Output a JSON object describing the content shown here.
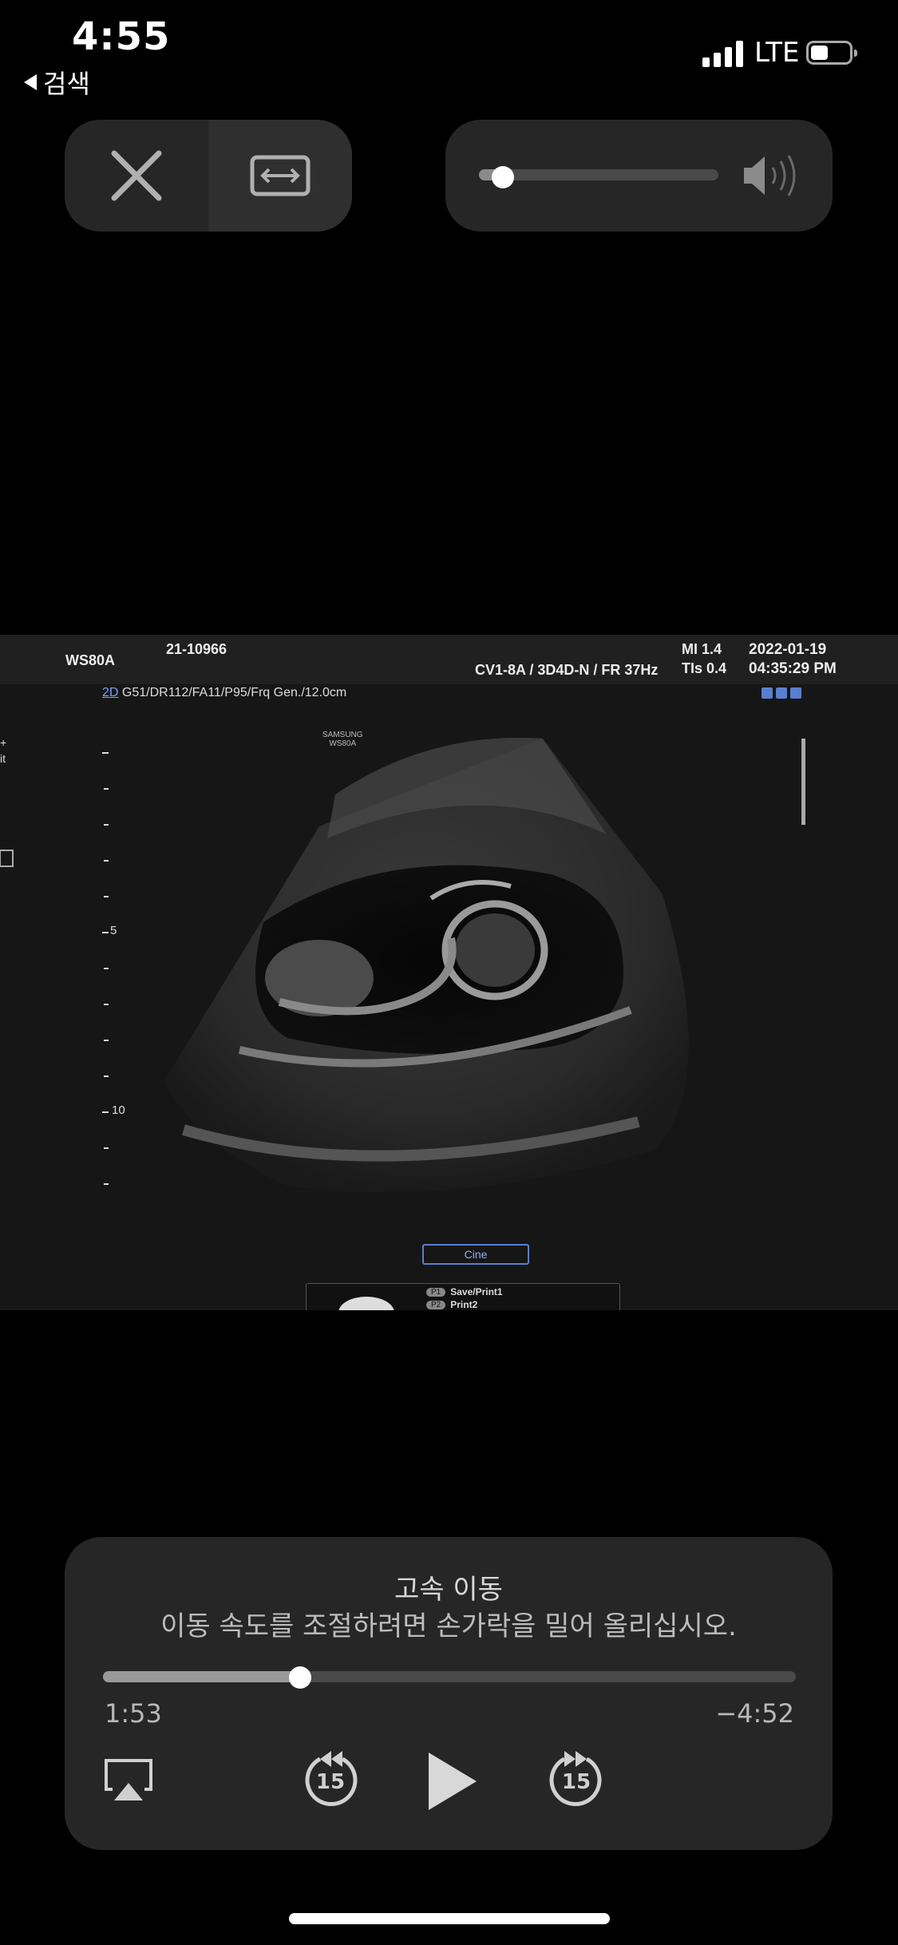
{
  "status_bar": {
    "time": "4:55",
    "back_label": "검색",
    "network": "LTE",
    "battery_level": 0.45
  },
  "controls": {
    "close_icon": "close-x-icon",
    "aspect_icon": "expand-horizontal-icon",
    "volume_level": 0.1,
    "volume_icon": "speaker-icon"
  },
  "video": {
    "model": "WS80A",
    "patient_id": "21-10966",
    "probe_info": "CV1-8A / 3D4D-N / FR 37Hz",
    "mi": "MI  1.4",
    "tis": "TIs 0.4",
    "date": "2022-01-19",
    "time": "04:35:29 PM",
    "mode": "2D",
    "params": "G51/DR112/FA11/P95/Frq Gen./12.0cm",
    "brand_line1": "SAMSUNG",
    "brand_line2": "WS80A",
    "depth_5": "5",
    "depth_10": "10",
    "cine_label": "Cine",
    "p1_badge": "P1",
    "p1_label": "Save/Print1",
    "p2_badge": "P2",
    "p2_label": "Print2"
  },
  "player": {
    "title": "고속 이동",
    "subtitle": "이동 속도를 조절하려면 손가락을 밀어 올리십시오.",
    "progress": 0.285,
    "elapsed": "1:53",
    "remaining": "−4:52",
    "skip_back_seconds": "15",
    "skip_forward_seconds": "15",
    "airplay_icon": "airplay-icon",
    "play_icon": "play-icon"
  }
}
